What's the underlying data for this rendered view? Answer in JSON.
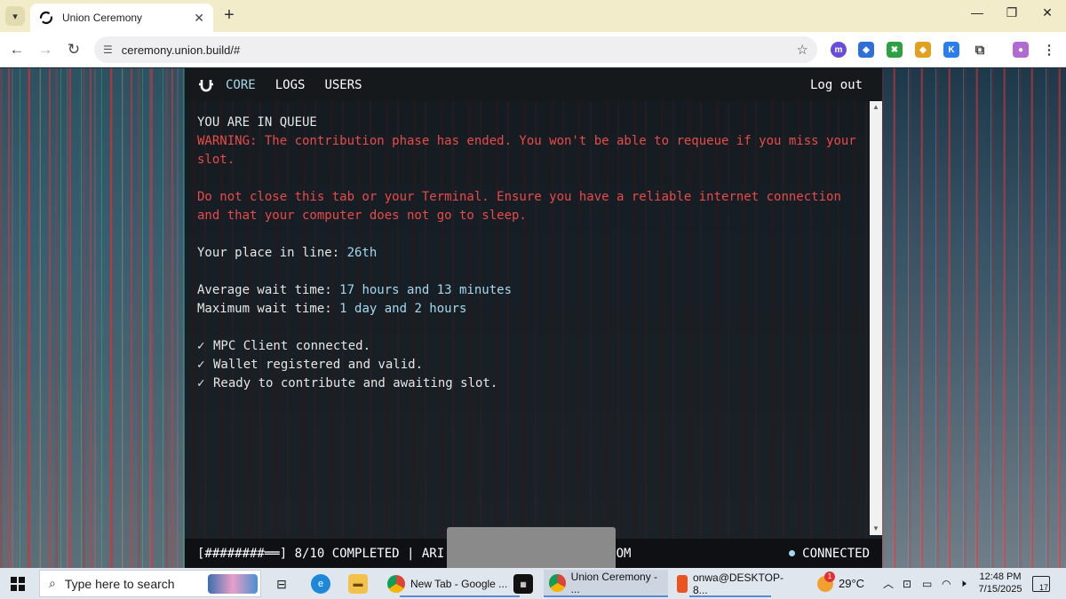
{
  "browser": {
    "tab_title": "Union Ceremony",
    "url": "ceremony.union.build/#",
    "new_tab_symbol": "+",
    "tab_close_symbol": "✕",
    "window_controls": {
      "minimize": "—",
      "restore": "❐",
      "close": "✕"
    }
  },
  "header": {
    "nav": [
      {
        "label": "CORE",
        "active": true
      },
      {
        "label": "LOGS",
        "active": false
      },
      {
        "label": "USERS",
        "active": false
      }
    ],
    "logout_label": "Log out"
  },
  "main": {
    "queue_title": "YOU ARE IN QUEUE",
    "warning_line1": "WARNING: The contribution phase has ended. You won't be able to requeue if you miss your",
    "warning_line2": "slot.",
    "notice_line1": "Do not close this tab or your Terminal. Ensure you have a reliable internet connection",
    "notice_line2": "and that your computer does not go to sleep.",
    "place_label": "Your place in line: ",
    "place_value": "26th",
    "avg_label": "Average wait time: ",
    "avg_value": "17 hours and 13 minutes",
    "max_label": "Maximum wait time: ",
    "max_value": "1 day and 2 hours",
    "check_mark": "✓",
    "checks": [
      "MPC Client connected.",
      "Wallet registered and valid.",
      "Ready to contribute and awaiting slot."
    ]
  },
  "footer": {
    "progress_bar": "[########══]",
    "progress_text": " 8/10 COMPLETED | ARI",
    "progress_completed": 8,
    "progress_total": 10,
    "email_suffix": "COM",
    "status": "CONNECTED"
  },
  "taskbar": {
    "search_placeholder": "Type here to search",
    "tasks": [
      {
        "label": "New Tab - Google ..."
      },
      {
        "label": "Union Ceremony - ..."
      },
      {
        "label": "onwa@DESKTOP-8..."
      }
    ],
    "weather": "29°C",
    "time": "12:48 PM",
    "date": "7/15/2025",
    "notification_count": "17",
    "weather_badge": "1"
  },
  "colors": {
    "accent": "#a5d8ee",
    "warning": "#e84b4b",
    "terminal_bg": "#16191c"
  }
}
